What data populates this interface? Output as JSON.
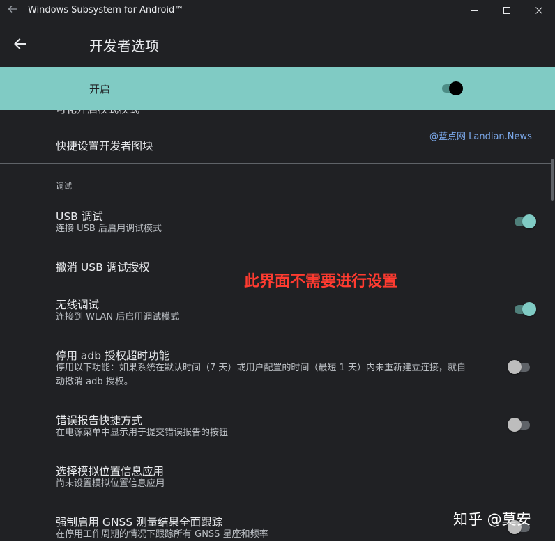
{
  "window": {
    "title": "Windows Subsystem for Android™"
  },
  "appbar": {
    "title": "开发者选项"
  },
  "master_switch": {
    "label": "开启",
    "state": "on"
  },
  "clipped_item": {
    "label": "可化开启模式模式"
  },
  "items": {
    "quick_tiles": {
      "title": "快捷设置开发者图块"
    },
    "section_debug": {
      "header": "调试"
    },
    "usb_debug": {
      "title": "USB 调试",
      "summary": "连接 USB 后启用调试模式",
      "state": "on"
    },
    "revoke_usb": {
      "title": "撤消 USB 调试授权"
    },
    "wireless_debug": {
      "title": "无线调试",
      "summary": "连接到 WLAN 后启用调试模式",
      "state": "on"
    },
    "adb_timeout": {
      "title": "停用 adb 授权超时功能",
      "summary_line1": "停用以下功能：如果系统在默认时间（7 天）或用户配置的时间（最短 1 天）内未重新建立连接，就自",
      "summary_line2": "动撤消 adb 授权。",
      "state": "off"
    },
    "bugreport_shortcut": {
      "title": "错误报告快捷方式",
      "summary": "在电源菜单中显示用于提交错误报告的按钮",
      "state": "off"
    },
    "mock_location": {
      "title": "选择模拟位置信息应用",
      "summary": "尚未设置模拟位置信息应用"
    },
    "gnss": {
      "title": "强制启用 GNSS 测量结果全面跟踪",
      "summary": "在停用工作周期的情况下跟踪所有 GNSS 星座和频率",
      "state": "off"
    }
  },
  "overlays": {
    "watermark_top": "@蓝点网 Landian.News",
    "annotation": "此界面不需要进行设置",
    "watermark_bottom": "知乎 @莫安"
  },
  "colors": {
    "accent": "#80cbc4",
    "background": "#202124",
    "annotation": "#ff3b30"
  }
}
